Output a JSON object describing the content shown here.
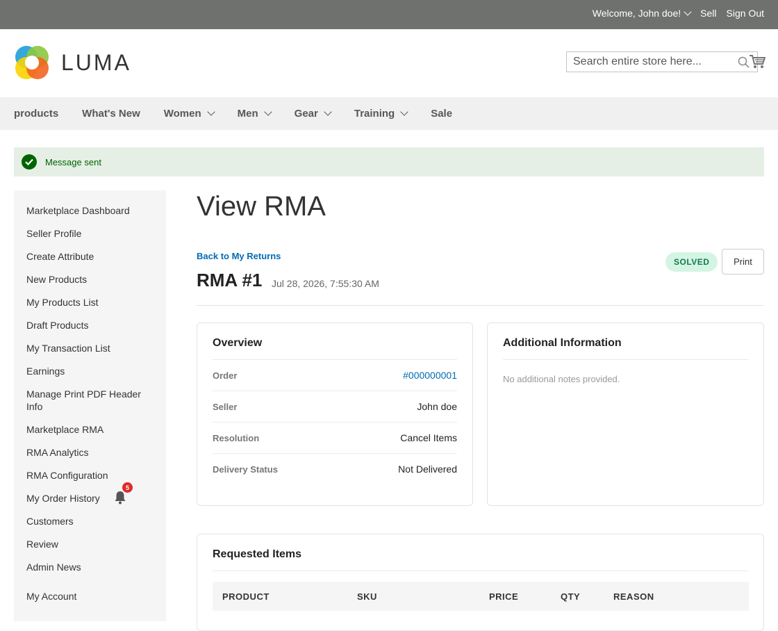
{
  "topbar": {
    "welcome": "Welcome, John doe!",
    "sell": "Sell",
    "sign_out": "Sign Out"
  },
  "header": {
    "logo_text": "LUMA",
    "search_placeholder": "Search entire store here...",
    "icons": [
      "search-icon",
      "cart-icon"
    ]
  },
  "nav": {
    "items": [
      {
        "label": "products",
        "dropdown": false
      },
      {
        "label": "What's New",
        "dropdown": false
      },
      {
        "label": "Women",
        "dropdown": true
      },
      {
        "label": "Men",
        "dropdown": true
      },
      {
        "label": "Gear",
        "dropdown": true
      },
      {
        "label": "Training",
        "dropdown": true
      },
      {
        "label": "Sale",
        "dropdown": false
      }
    ]
  },
  "message": {
    "text": "Message sent",
    "color": "#006400"
  },
  "sidebar": {
    "items": [
      "Marketplace Dashboard",
      "Seller Profile",
      "Create Attribute",
      "New Products",
      "My Products List",
      "Draft Products",
      "My Transaction List",
      "Earnings",
      "Manage Print PDF Header Info",
      "Marketplace RMA",
      "RMA Analytics",
      "RMA Configuration",
      "My Order History",
      "Customers",
      "Review",
      "Admin News",
      "My Account"
    ],
    "notification_count": "5"
  },
  "main": {
    "title": "View RMA",
    "back_link": "Back to My Returns",
    "rma_number": "RMA #1",
    "rma_date": "Jul 28, 2026, 7:55:30 AM",
    "status": "SOLVED",
    "status_color": "#137a47",
    "print_label": "Print",
    "overview": {
      "title": "Overview",
      "rows": [
        {
          "label": "Order",
          "value": "#000000001"
        },
        {
          "label": "Seller",
          "value": "John doe"
        },
        {
          "label": "Resolution",
          "value": "Cancel Items"
        },
        {
          "label": "Delivery Status",
          "value": "Not Delivered"
        }
      ]
    },
    "additional_info": {
      "title": "Additional Information",
      "note": "No additional notes provided."
    },
    "requested_items": {
      "title": "Requested Items",
      "columns": [
        "PRODUCT",
        "SKU",
        "PRICE",
        "QTY",
        "REASON"
      ]
    }
  }
}
